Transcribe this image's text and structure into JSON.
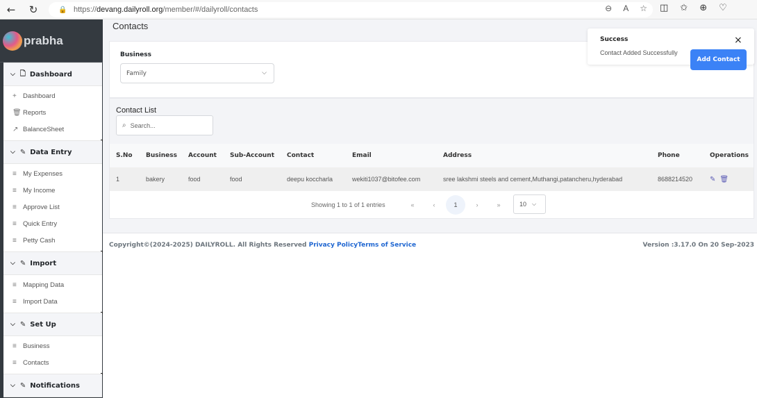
{
  "browser": {
    "url_prefix": "https://",
    "url_host": "devang.dailyroll.org",
    "url_path": "/member/#/dailyroll/contacts",
    "icons": [
      "back-icon",
      "refresh-icon",
      "lock-icon",
      "zoom-out-icon",
      "read-aloud-icon",
      "favorite-star-icon",
      "split-screen-icon",
      "favorites-icon",
      "collections-icon",
      "health-icon"
    ]
  },
  "sidebar": {
    "brand": "prabha",
    "groups": [
      {
        "label": "Dashboard",
        "icon": "file-icon",
        "items": [
          {
            "label": "Dashboard",
            "icon": "plus-icon"
          },
          {
            "label": "Reports",
            "icon": "trash-icon"
          },
          {
            "label": "BalanceSheet",
            "icon": "external-link-icon"
          }
        ]
      },
      {
        "label": "Data Entry",
        "icon": "pencil-icon",
        "items": [
          {
            "label": "My Expenses",
            "icon": "list-icon"
          },
          {
            "label": "My Income",
            "icon": "list-icon"
          },
          {
            "label": "Approve List",
            "icon": "list-icon"
          },
          {
            "label": "Quick Entry",
            "icon": "list-icon"
          },
          {
            "label": "Petty Cash",
            "icon": "list-icon"
          }
        ]
      },
      {
        "label": "Import",
        "icon": "pencil-icon",
        "items": [
          {
            "label": "Mapping Data",
            "icon": "list-icon"
          },
          {
            "label": "Import Data",
            "icon": "list-icon"
          }
        ]
      },
      {
        "label": "Set Up",
        "icon": "pencil-icon",
        "items": [
          {
            "label": "Business",
            "icon": "list-icon"
          },
          {
            "label": "Contacts",
            "icon": "list-icon"
          }
        ]
      },
      {
        "label": "Notifications",
        "icon": "pencil-icon",
        "items": []
      }
    ]
  },
  "page": {
    "title": "Contacts",
    "business_label": "Business",
    "business_value": "Family",
    "add_contact_label": "Add Contact"
  },
  "toast": {
    "title": "Success",
    "message": "Contact Added Successfully",
    "close": "×"
  },
  "contact_list": {
    "title": "Contact List",
    "search_placeholder": "Search...",
    "columns": [
      "S.No",
      "Business",
      "Account",
      "Sub-Account",
      "Contact",
      "Email",
      "Address",
      "Phone",
      "Operations"
    ],
    "rows": [
      {
        "sno": "1",
        "business": "bakery",
        "account": "food",
        "sub_account": "food",
        "contact": "deepu koccharla",
        "email": "wekiti1037@bitofee.com",
        "address": "sree lakshmi steels and cement,Muthangi,patancheru,hyderabad",
        "phone": "8688214520"
      }
    ],
    "pagination": {
      "info": "Showing 1 to 1 of 1 entries",
      "first": "«",
      "prev": "‹",
      "current": "1",
      "next": "›",
      "last": "»",
      "page_size": "10"
    }
  },
  "footer": {
    "copyright": "Copyright©(2024-2025) DAILYROLL. All Rights Reserved ",
    "privacy": "Privacy Policy",
    "terms": "Terms of Service",
    "version": "Version :3.17.0 On 20 Sep-2023"
  }
}
